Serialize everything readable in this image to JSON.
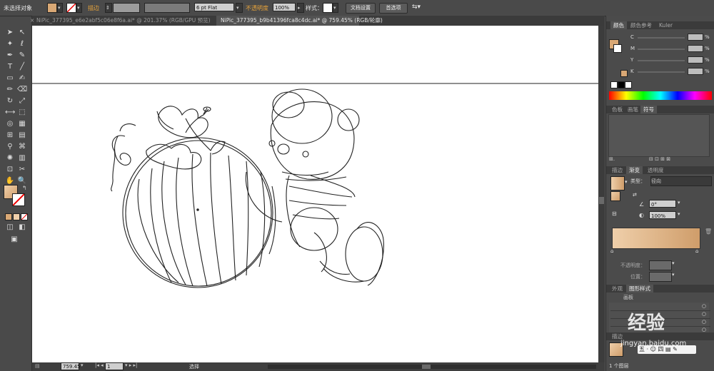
{
  "control_bar": {
    "selection_label": "未选择对象",
    "stroke_label": "描边",
    "brush_value": "6 pt Flat",
    "opacity_label": "不透明度",
    "opacity_value": "100%",
    "style_label": "样式：",
    "doc_setup_button": "文档设置",
    "preferences_button": "首选项"
  },
  "tabs": [
    {
      "label": "NiPic_377395_e6e2abf5c06e8f6a.ai* @ 201.37% (RGB/GPU 预览)",
      "active": false
    },
    {
      "label": "NiPic_377395_b9b41396fca8c4dc.ai* @ 759.45% (RGB/轮廓)",
      "active": true
    }
  ],
  "color_panel": {
    "tabs": [
      "颜色",
      "颜色参考",
      "Kuler"
    ],
    "channels": [
      "C",
      "M",
      "Y",
      "K"
    ],
    "pct": "%"
  },
  "swatch_panel": {
    "tabs": [
      "色板",
      "画笔",
      "符号"
    ]
  },
  "gradient_panel": {
    "tabs": [
      "描边",
      "渐变",
      "透明度"
    ],
    "type_label": "类型：",
    "type_value": "径向",
    "angle_value": "0°",
    "ratio_value": "100%",
    "opacity_label": "不透明度：",
    "position_label": "位置："
  },
  "appearance_panel": {
    "tabs": [
      "外观",
      "图形样式"
    ],
    "row_label": "画板"
  },
  "layers_panel": {
    "tab": "描边",
    "layer_count": "1 个图层"
  },
  "status_bar": {
    "zoom": "759.45",
    "page": "1",
    "mode": "选择"
  },
  "watermark": {
    "line1": "经验",
    "line2": "jingyan.baidu.com"
  },
  "colors": {
    "fill": "#d9a875",
    "gradient_start": "#efcfaa",
    "gradient_end": "#cf9d6a",
    "accent_orange": "#e7a33b"
  }
}
